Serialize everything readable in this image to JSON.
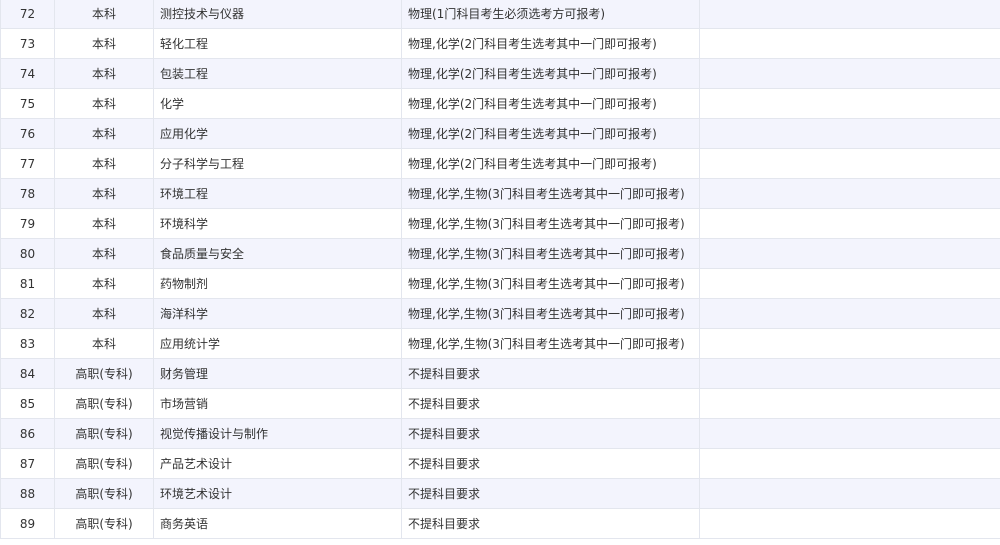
{
  "rows": [
    {
      "no": "72",
      "level": "本科",
      "major": "测控技术与仪器",
      "requirement": "物理(1门科目考生必须选考方可报考)",
      "extra": ""
    },
    {
      "no": "73",
      "level": "本科",
      "major": "轻化工程",
      "requirement": "物理,化学(2门科目考生选考其中一门即可报考)",
      "extra": ""
    },
    {
      "no": "74",
      "level": "本科",
      "major": "包装工程",
      "requirement": "物理,化学(2门科目考生选考其中一门即可报考)",
      "extra": ""
    },
    {
      "no": "75",
      "level": "本科",
      "major": "化学",
      "requirement": "物理,化学(2门科目考生选考其中一门即可报考)",
      "extra": ""
    },
    {
      "no": "76",
      "level": "本科",
      "major": "应用化学",
      "requirement": "物理,化学(2门科目考生选考其中一门即可报考)",
      "extra": ""
    },
    {
      "no": "77",
      "level": "本科",
      "major": "分子科学与工程",
      "requirement": "物理,化学(2门科目考生选考其中一门即可报考)",
      "extra": ""
    },
    {
      "no": "78",
      "level": "本科",
      "major": "环境工程",
      "requirement": "物理,化学,生物(3门科目考生选考其中一门即可报考)",
      "extra": ""
    },
    {
      "no": "79",
      "level": "本科",
      "major": "环境科学",
      "requirement": "物理,化学,生物(3门科目考生选考其中一门即可报考)",
      "extra": ""
    },
    {
      "no": "80",
      "level": "本科",
      "major": "食品质量与安全",
      "requirement": "物理,化学,生物(3门科目考生选考其中一门即可报考)",
      "extra": ""
    },
    {
      "no": "81",
      "level": "本科",
      "major": "药物制剂",
      "requirement": "物理,化学,生物(3门科目考生选考其中一门即可报考)",
      "extra": ""
    },
    {
      "no": "82",
      "level": "本科",
      "major": "海洋科学",
      "requirement": "物理,化学,生物(3门科目考生选考其中一门即可报考)",
      "extra": ""
    },
    {
      "no": "83",
      "level": "本科",
      "major": "应用统计学",
      "requirement": "物理,化学,生物(3门科目考生选考其中一门即可报考)",
      "extra": ""
    },
    {
      "no": "84",
      "level": "高职(专科)",
      "major": "财务管理",
      "requirement": "不提科目要求",
      "extra": ""
    },
    {
      "no": "85",
      "level": "高职(专科)",
      "major": "市场营销",
      "requirement": "不提科目要求",
      "extra": ""
    },
    {
      "no": "86",
      "level": "高职(专科)",
      "major": "视觉传播设计与制作",
      "requirement": "不提科目要求",
      "extra": ""
    },
    {
      "no": "87",
      "level": "高职(专科)",
      "major": "产品艺术设计",
      "requirement": "不提科目要求",
      "extra": ""
    },
    {
      "no": "88",
      "level": "高职(专科)",
      "major": "环境艺术设计",
      "requirement": "不提科目要求",
      "extra": ""
    },
    {
      "no": "89",
      "level": "高职(专科)",
      "major": "商务英语",
      "requirement": "不提科目要求",
      "extra": ""
    }
  ],
  "colors": {
    "row_alt": "#f3f4fd",
    "row_plain": "#ffffff",
    "border": "#e3e6ee",
    "text": "#333333"
  }
}
